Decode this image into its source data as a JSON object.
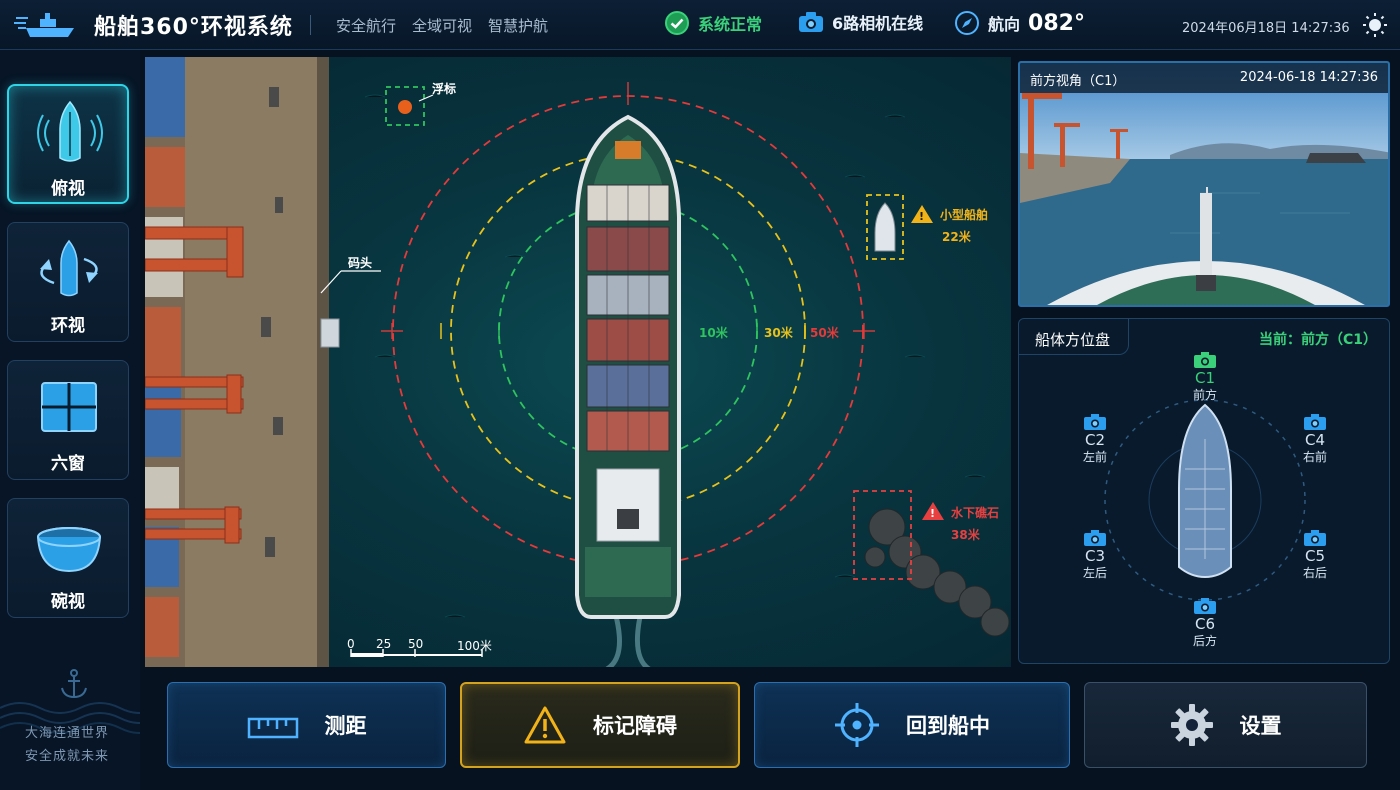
{
  "app": {
    "title": "船舶360°环视系统",
    "slogans": [
      "安全航行",
      "全域可视",
      "智慧护航"
    ]
  },
  "status": {
    "system": "系统正常",
    "cameras": "6路相机在线",
    "heading_label": "航向",
    "heading_value": "082°",
    "datetime": "2024年06月18日   14:27:36"
  },
  "nav": {
    "items": [
      {
        "label": "俯视",
        "icon": "top-view-ship-icon",
        "active": true
      },
      {
        "label": "环视",
        "icon": "surround-view-icon",
        "active": false
      },
      {
        "label": "六窗",
        "icon": "six-window-grid-icon",
        "active": false
      },
      {
        "label": "碗视",
        "icon": "bowl-view-icon",
        "active": false
      }
    ],
    "footer_line1": "大海连通世界",
    "footer_line2": "安全成就未来"
  },
  "map": {
    "buoy_label": "浮标",
    "dock_label": "码头",
    "small_boat_label": "小型船舶",
    "small_boat_distance": "22米",
    "reef_label": "水下礁石",
    "reef_distance": "38米",
    "ring_inner": "10米",
    "ring_middle": "30米",
    "ring_outer": "50米",
    "scale": {
      "t0": "0",
      "t1": "25",
      "t2": "50",
      "t3": "100米"
    },
    "colors": {
      "ring_inner": "#2fc45e",
      "ring_middle": "#e8c21a",
      "ring_outer": "#e63a3a",
      "warning": "#f2b318",
      "danger": "#e84040"
    }
  },
  "camera_view": {
    "title": "前方视角（C1）",
    "timestamp": "2024-06-18  14:27:36"
  },
  "compass": {
    "title": "船体方位盘",
    "current": "当前：前方（C1）",
    "cameras": [
      {
        "code": "C1",
        "dir": "前方",
        "active": true
      },
      {
        "code": "C2",
        "dir": "左前",
        "active": false
      },
      {
        "code": "C4",
        "dir": "右前",
        "active": false
      },
      {
        "code": "C3",
        "dir": "左后",
        "active": false
      },
      {
        "code": "C5",
        "dir": "右后",
        "active": false
      },
      {
        "code": "C6",
        "dir": "后方",
        "active": false
      }
    ]
  },
  "buttons": {
    "measure": "测距",
    "mark_obstacle": "标记障碍",
    "recenter": "回到船中",
    "settings": "设置"
  }
}
